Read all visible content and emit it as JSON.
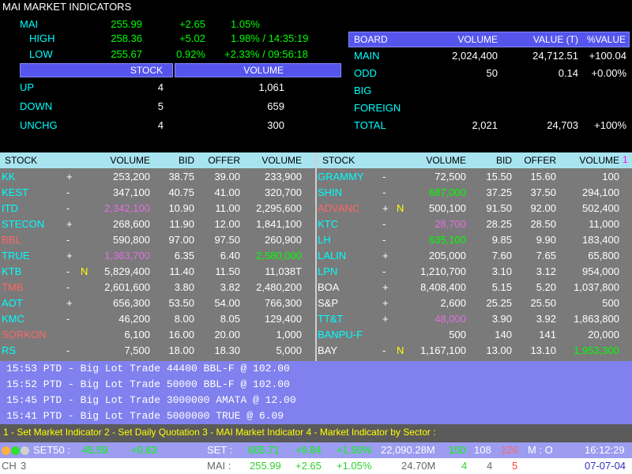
{
  "title": "MAI MARKET INDICATORS",
  "index": {
    "label": "MAI",
    "value": "255.99",
    "change": "+2.65",
    "pct": "1.05%"
  },
  "high": {
    "label": "HIGH",
    "value": "258.36",
    "change": "+5.02",
    "pct": "1.98% / 14:35:19"
  },
  "low": {
    "label": "LOW",
    "value": "255.67",
    "change": "0.92%",
    "pct": "+2.33% / 09:56:18"
  },
  "breadth": {
    "stock_header": "STOCK",
    "volume_header": "VOLUME",
    "rows": [
      {
        "label": "UP",
        "stock": "4",
        "volume": "1,061"
      },
      {
        "label": "DOWN",
        "stock": "5",
        "volume": "659"
      },
      {
        "label": "UNCHG",
        "stock": "4",
        "volume": "300"
      }
    ]
  },
  "board": {
    "headers": [
      "BOARD",
      "VOLUME",
      "VALUE (T)",
      "%VALUE"
    ],
    "rows": [
      {
        "label": "MAIN",
        "volume": "2,024,400",
        "value": "24,712.51",
        "pct": "+100.04"
      },
      {
        "label": "ODD",
        "volume": "50",
        "value": "0.14",
        "pct": "+0.00%"
      },
      {
        "label": "BIG",
        "volume": "",
        "value": "",
        "pct": ""
      },
      {
        "label": "FOREIGN",
        "volume": "",
        "value": "",
        "pct": ""
      },
      {
        "label": "TOTAL",
        "volume": "2,021",
        "value": "24,703",
        "pct": "+100%"
      }
    ]
  },
  "grid": {
    "headers": [
      "STOCK",
      "VOLUME",
      "BID",
      "OFFER",
      "VOLUME"
    ],
    "page_marker": "1",
    "left": [
      {
        "s": "KK",
        "sc": "cy",
        "sign": "+",
        "flag": "",
        "bv": "253,200",
        "bvc": "wh",
        "bid": "38.75",
        "offer": "39.00",
        "ov": "233,900",
        "ovc": "wh"
      },
      {
        "s": "KEST",
        "sc": "cy",
        "sign": "-",
        "flag": "",
        "bv": "347,100",
        "bvc": "wh",
        "bid": "40.75",
        "offer": "41.00",
        "ov": "320,700",
        "ovc": "wh"
      },
      {
        "s": "ITD",
        "sc": "cy",
        "sign": "-",
        "flag": "",
        "bv": "2,342,100",
        "bvc": "vi",
        "bid": "10.90",
        "offer": "11.00",
        "ov": "2,295,600",
        "ovc": "wh"
      },
      {
        "s": "STECON",
        "sc": "cy",
        "sign": "+",
        "flag": "",
        "bv": "268,600",
        "bvc": "wh",
        "bid": "11.90",
        "offer": "12.00",
        "ov": "1,841,100",
        "ovc": "wh"
      },
      {
        "s": "BBL",
        "sc": "pk",
        "sign": "-",
        "flag": "",
        "bv": "590,800",
        "bvc": "wh",
        "bid": "97.00",
        "offer": "97.50",
        "ov": "260,900",
        "ovc": "wh"
      },
      {
        "s": "TRUE",
        "sc": "cy",
        "sign": "+",
        "flag": "",
        "bv": "1,363,700",
        "bvc": "vi",
        "bid": "6.35",
        "offer": "6.40",
        "ov": "2,580,000",
        "ovc": "gr"
      },
      {
        "s": "KTB",
        "sc": "cy",
        "sign": "-",
        "flag": "N",
        "bv": "5,829,400",
        "bvc": "wh",
        "bid": "11.40",
        "offer": "11.50",
        "ov": "11,038T",
        "ovc": "wh"
      },
      {
        "s": "TMB",
        "sc": "pk",
        "sign": "-",
        "flag": "",
        "bv": "2,601,600",
        "bvc": "wh",
        "bid": "3.80",
        "offer": "3.82",
        "ov": "2,480,200",
        "ovc": "wh"
      },
      {
        "s": "AOT",
        "sc": "cy",
        "sign": "+",
        "flag": "",
        "bv": "656,300",
        "bvc": "wh",
        "bid": "53.50",
        "offer": "54.00",
        "ov": "766,300",
        "ovc": "wh"
      },
      {
        "s": "KMC",
        "sc": "cy",
        "sign": "-",
        "flag": "",
        "bv": "46,200",
        "bvc": "wh",
        "bid": "8.00",
        "offer": "8.05",
        "ov": "129,400",
        "ovc": "wh"
      },
      {
        "s": "SORKON",
        "sc": "pk",
        "sign": "",
        "flag": "",
        "bv": "6,100",
        "bvc": "wh",
        "bid": "16.00",
        "offer": "20.00",
        "ov": "1,000",
        "ovc": "wh"
      },
      {
        "s": "RS",
        "sc": "cy",
        "sign": "-",
        "flag": "",
        "bv": "7,500",
        "bvc": "wh",
        "bid": "18.00",
        "offer": "18.30",
        "ov": "5,000",
        "ovc": "wh"
      }
    ],
    "right": [
      {
        "s": "GRAMMY",
        "sc": "cy",
        "sign": "-",
        "flag": "",
        "bv": "72,500",
        "bvc": "wh",
        "bid": "15.50",
        "offer": "15.60",
        "ov": "100",
        "ovc": "wh"
      },
      {
        "s": "SHIN",
        "sc": "cy",
        "sign": "-",
        "flag": "",
        "bv": "687,000",
        "bvc": "gr",
        "bid": "37.25",
        "offer": "37.50",
        "ov": "294,100",
        "ovc": "wh"
      },
      {
        "s": "ADVANC",
        "sc": "pk",
        "sign": "+",
        "flag": "N",
        "bv": "500,100",
        "bvc": "wh",
        "bid": "91.50",
        "offer": "92.00",
        "ov": "502,400",
        "ovc": "wh"
      },
      {
        "s": "KTC",
        "sc": "cy",
        "sign": "-",
        "flag": "",
        "bv": "28,700",
        "bvc": "vi",
        "bid": "28.25",
        "offer": "28.50",
        "ov": "11,000",
        "ovc": "wh"
      },
      {
        "s": "LH",
        "sc": "cy",
        "sign": "-",
        "flag": "",
        "bv": "635,100",
        "bvc": "gr",
        "bid": "9.85",
        "offer": "9.90",
        "ov": "183,400",
        "ovc": "wh"
      },
      {
        "s": "LALIN",
        "sc": "cy",
        "sign": "+",
        "flag": "",
        "bv": "205,000",
        "bvc": "wh",
        "bid": "7.60",
        "offer": "7.65",
        "ov": "65,800",
        "ovc": "wh"
      },
      {
        "s": "LPN",
        "sc": "cy",
        "sign": "-",
        "flag": "",
        "bv": "1,210,700",
        "bvc": "wh",
        "bid": "3.10",
        "offer": "3.12",
        "ov": "954,000",
        "ovc": "wh"
      },
      {
        "s": "BOA",
        "sc": "wh",
        "sign": "+",
        "flag": "",
        "bv": "8,408,400",
        "bvc": "wh",
        "bid": "5.15",
        "offer": "5.20",
        "ov": "1,037,800",
        "ovc": "wh"
      },
      {
        "s": "S&P",
        "sc": "wh",
        "sign": "+",
        "flag": "",
        "bv": "2,600",
        "bvc": "wh",
        "bid": "25.25",
        "offer": "25.50",
        "ov": "500",
        "ovc": "wh"
      },
      {
        "s": "TT&T",
        "sc": "cy",
        "sign": "+",
        "flag": "",
        "bv": "48,000",
        "bvc": "vi",
        "bid": "3.90",
        "offer": "3.92",
        "ov": "1,863,800",
        "ovc": "wh"
      },
      {
        "s": "BANPU-F",
        "sc": "cy",
        "sign": "",
        "flag": "",
        "bv": "500",
        "bvc": "wh",
        "bid": "140",
        "offer": "141",
        "ov": "20,000",
        "ovc": "wh"
      },
      {
        "s": "BAY",
        "sc": "wh",
        "sign": "-",
        "flag": "N",
        "bv": "1,167,100",
        "bvc": "wh",
        "bid": "13.00",
        "offer": "13.10",
        "ov": "1,953,300",
        "ovc": "gr"
      }
    ]
  },
  "ticker": [
    "15:53 PTD - Big Lot Trade 44400 BBL-F     @ 102.00",
    "15:52 PTD - Big Lot Trade 50000 BBL-F     @ 102.00",
    "15:45 PTD - Big Lot Trade 3000000 AMATA   @ 12.00",
    "15:41 PTD - Big Lot Trade 5000000 TRUE    @ 6.09"
  ],
  "keys": "1 - Set Market Indicator  2 - Set Daily Quotation  3 - MAI Market Indicator  4 - Market Indicator by Sector :",
  "status1": {
    "set50_label": "SET50 :",
    "set50": "45.59",
    "set50_chg": "+0.63",
    "set_label": "SET :",
    "set": "665.71",
    "set_chg": "+9.84",
    "set_pct": "+1.50%",
    "value": "22,090.28M",
    "up": "150",
    "unch": "108",
    "down": "126",
    "mode": "M : O",
    "time": "16:12:29"
  },
  "status2": {
    "ch_label": "CH",
    "ch": "3",
    "mai_label": "MAI :",
    "mai": "255.99",
    "mai_chg": "+2.65",
    "mai_pct": "+1.05%",
    "mai_value": "24.70M",
    "up": "4",
    "unch": "4",
    "down": "5",
    "date": "07-07-04"
  },
  "colors": {
    "cyan": "#00ffff",
    "green": "#00ff00",
    "pink": "#ff6666",
    "violet": "#e070e0",
    "yellow": "#ffff00",
    "grid_bg": "#7a7a7a",
    "ticker_bg": "#8080ee",
    "header_bg": "#a8e4f0"
  }
}
